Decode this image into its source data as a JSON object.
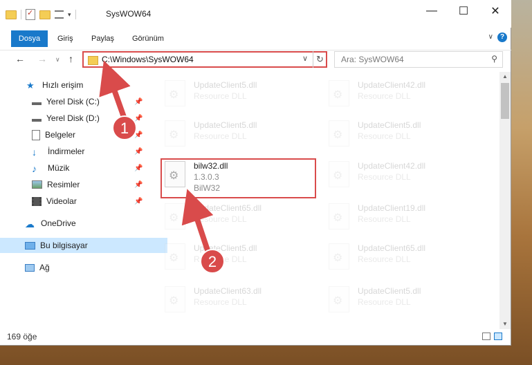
{
  "window": {
    "title": "SysWOW64",
    "minimize": "—",
    "maximize": "☐",
    "close": "✕"
  },
  "ribbon": {
    "tabs": [
      "Dosya",
      "Giriş",
      "Paylaş",
      "Görünüm"
    ],
    "help": "?",
    "expand": "∨"
  },
  "nav": {
    "back": "←",
    "forward": "→",
    "recent": "∨",
    "up": "↑",
    "address": "C:\\Windows\\SysWOW64",
    "address_dropdown": "∨",
    "refresh": "↻",
    "search_placeholder": "Ara: SysWOW64",
    "search_icon": "⚲"
  },
  "sidebar": {
    "items": [
      {
        "label": "Hızlı erişim",
        "icon": "star-icon"
      },
      {
        "label": "Yerel Disk (C:)",
        "icon": "drive-icon",
        "pinned": true
      },
      {
        "label": "Yerel Disk (D:)",
        "icon": "drive-icon",
        "pinned": true
      },
      {
        "label": "Belgeler",
        "icon": "documents-icon",
        "pinned": true
      },
      {
        "label": "İndirmeler",
        "icon": "downloads-icon",
        "pinned": true
      },
      {
        "label": "Müzik",
        "icon": "music-icon",
        "pinned": true
      },
      {
        "label": "Resimler",
        "icon": "pictures-icon",
        "pinned": true
      },
      {
        "label": "Videolar",
        "icon": "videos-icon",
        "pinned": true
      },
      {
        "label": "OneDrive",
        "icon": "cloud-icon"
      },
      {
        "label": "Bu bilgisayar",
        "icon": "computer-icon",
        "selected": true
      },
      {
        "label": "Ağ",
        "icon": "network-icon"
      }
    ],
    "pin_glyph": "📌"
  },
  "files": {
    "left_column": [
      {
        "name": "UpdateClient5.dll",
        "desc": "Resource DLL",
        "faded": true
      },
      {
        "name": "UpdateClient5.dll",
        "desc": "Resource DLL",
        "faded": true
      },
      {
        "name": "bilw32.dll",
        "version": "1.3.0.3",
        "desc": "BilW32",
        "faded": false
      },
      {
        "name": "UpdateClient65.dll",
        "desc": "Resource DLL",
        "faded": true
      },
      {
        "name": "UpdateClient5.dll",
        "desc": "Resource DLL",
        "faded": true
      },
      {
        "name": "UpdateClient63.dll",
        "desc": "Resource DLL",
        "faded": true
      }
    ],
    "right_column": [
      {
        "name": "UpdateClient42.dll",
        "desc": "Resource DLL",
        "faded": true
      },
      {
        "name": "UpdateClient5.dll",
        "desc": "Resource DLL",
        "faded": true
      },
      {
        "name": "UpdateClient42.dll",
        "desc": "Resource DLL",
        "faded": true
      },
      {
        "name": "UpdateClient19.dll",
        "desc": "Resource DLL",
        "faded": true
      },
      {
        "name": "UpdateClient65.dll",
        "desc": "Resource DLL",
        "faded": true
      },
      {
        "name": "UpdateClient5.dll",
        "desc": "Resource DLL",
        "faded": true
      }
    ]
  },
  "status": {
    "item_count": "169 öğe"
  },
  "annotations": {
    "step1": "1",
    "step2": "2",
    "color": "#d94b4b"
  },
  "colors": {
    "accent": "#1979ca",
    "selection": "#cce8ff",
    "highlight": "#d94b4b"
  }
}
